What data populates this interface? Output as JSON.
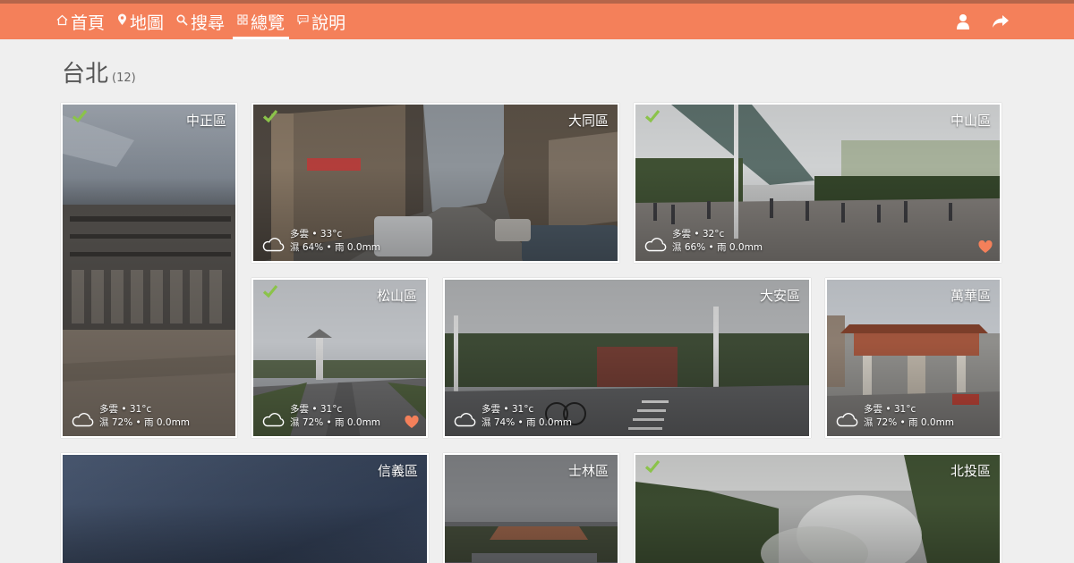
{
  "nav": {
    "items": [
      {
        "icon": "home-icon",
        "glyph": "⌂",
        "label": "首頁",
        "active": false
      },
      {
        "icon": "map-pin-icon",
        "glyph": "⚲",
        "label": "地圖",
        "active": false
      },
      {
        "icon": "search-icon",
        "glyph": "⚲",
        "label": "搜尋",
        "active": false
      },
      {
        "icon": "grid-icon",
        "glyph": "▦",
        "label": "總覽",
        "active": true
      },
      {
        "icon": "chat-icon",
        "glyph": "▭",
        "label": "說明",
        "active": false
      }
    ],
    "right_icons": [
      "user-icon",
      "share-icon"
    ]
  },
  "page": {
    "title": "台北",
    "count": "(12)"
  },
  "districts": [
    {
      "name": "中正區",
      "checked": true,
      "weather": null,
      "favorite": false
    },
    {
      "name": "大同區",
      "checked": true,
      "weather": {
        "line1": "多雲 • 33°c",
        "line2": "濕 64% • 雨 0.0mm"
      },
      "favorite": false
    },
    {
      "name": "中山區",
      "checked": true,
      "weather": {
        "line1": "多雲 • 32°c",
        "line2": "濕 66% • 雨 0.0mm"
      },
      "favorite": true
    },
    {
      "name": "松山區",
      "checked": true,
      "weather": {
        "line1": "多雲 • 31°c",
        "line2": "濕 72% • 雨 0.0mm"
      },
      "favorite": true
    },
    {
      "name": "大安區",
      "checked": false,
      "weather": {
        "line1": "多雲 • 31°c",
        "line2": "濕 74% • 雨 0.0mm"
      },
      "favorite": false
    },
    {
      "name": "萬華區",
      "checked": false,
      "weather": {
        "line1": "多雲 • 31°c",
        "line2": "濕 72% • 雨 0.0mm"
      },
      "favorite": false
    },
    {
      "name": "信義區",
      "checked": false,
      "weather": null,
      "favorite": false
    },
    {
      "name": "士林區",
      "checked": false,
      "weather": null,
      "favorite": false
    },
    {
      "name": "北投區",
      "checked": true,
      "weather": null,
      "favorite": false
    }
  ],
  "cards_extra": {
    "zhongzheng_weather": {
      "line1": "多雲 • 31°c",
      "line2": "濕 72% • 雨 0.0mm"
    }
  },
  "colors": {
    "accent": "#f4805a",
    "check": "#8bc34a",
    "heart": "#f4805a"
  }
}
